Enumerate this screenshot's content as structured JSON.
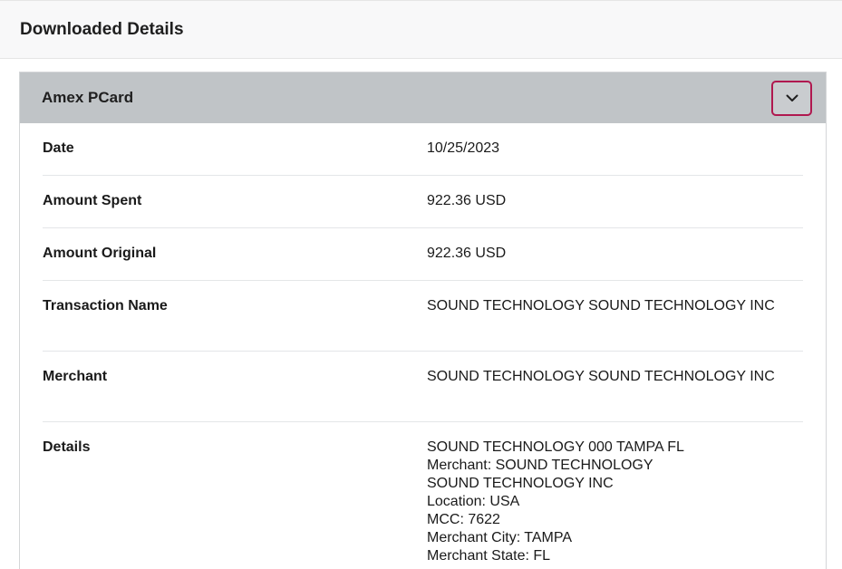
{
  "header": {
    "title": "Downloaded Details"
  },
  "panel": {
    "title": "Amex PCard",
    "toggle_icon": "chevron-down-icon",
    "accent_color": "#b0184f",
    "header_bg": "#c0c4c7"
  },
  "rows": [
    {
      "label": "Date",
      "value": "10/25/2023"
    },
    {
      "label": "Amount Spent",
      "value": "922.36 USD"
    },
    {
      "label": "Amount Original",
      "value": "922.36 USD"
    },
    {
      "label": "Transaction Name",
      "value": "SOUND TECHNOLOGY SOUND TECHNOLOGY INC"
    },
    {
      "label": "Merchant",
      "value": "SOUND TECHNOLOGY SOUND TECHNOLOGY INC"
    }
  ],
  "details": {
    "label": "Details",
    "lines": [
      "SOUND TECHNOLOGY 000 TAMPA FL",
      "Merchant: SOUND TECHNOLOGY",
      "SOUND TECHNOLOGY INC",
      "Location: USA",
      "MCC: 7622",
      "Merchant City: TAMPA",
      "Merchant State: FL"
    ]
  }
}
